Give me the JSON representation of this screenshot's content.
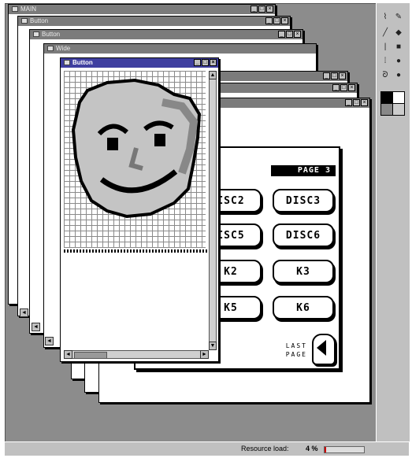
{
  "windows": {
    "main_title": "MAIN",
    "button_title_1": "Button",
    "button_title_2": "Button",
    "wide_title": "Wide",
    "active_title": "Button",
    "min_label": "_",
    "max_label": "□",
    "close_label": "×"
  },
  "page_panel": {
    "page_label": "PAGE 3",
    "buttons": [
      "ISC2",
      "DISC3",
      "ISC5",
      "DISC6",
      "K2",
      "K3",
      "K5",
      "K6"
    ],
    "last_page_label": "LAST PAGE"
  },
  "editor": {
    "scroll_left": "◄",
    "scroll_right": "►",
    "scroll_up": "▲",
    "scroll_down": "▼"
  },
  "status_bar": {
    "text": "Resource load:",
    "value": "4 %"
  },
  "colors": {
    "desktop": "#8c8c8c",
    "titlebar_active": "#3f3fa0",
    "face_fill": "#c4c4c4",
    "face_outline": "#000000"
  }
}
